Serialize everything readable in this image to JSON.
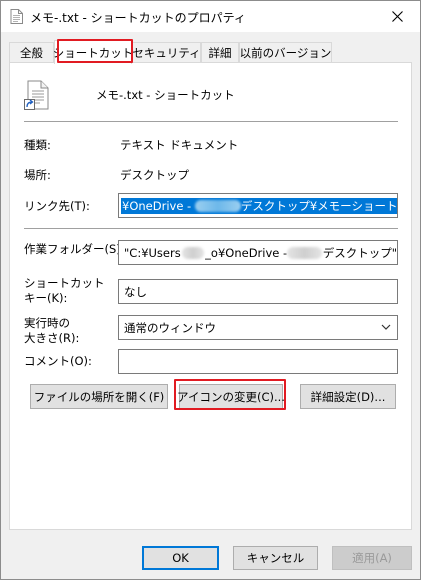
{
  "window": {
    "title": "メモ-.txt - ショートカットのプロパティ"
  },
  "tabs": [
    {
      "label": "全般"
    },
    {
      "label": "ショートカット"
    },
    {
      "label": "セキュリティ"
    },
    {
      "label": "詳細"
    },
    {
      "label": "以前のバージョン"
    }
  ],
  "shortcut": {
    "name": "メモ-.txt - ショートカット",
    "type_label": "種類:",
    "type_value": "テキスト ドキュメント",
    "location_label": "場所:",
    "location_value": "デスクトップ",
    "target_label": "リンク先(T):",
    "target_value_start": "¥OneDrive - ",
    "target_value_end": "デスクトップ¥メモーショートカット.txt\"",
    "startin_label": "作業フォルダー(S):",
    "startin_value_start": "\"C:¥Users",
    "startin_value_mid": "_o¥OneDrive - ",
    "startin_value_end": "デスクトップ\"",
    "hotkey_label_1": "ショートカット",
    "hotkey_label_2": "キー(K):",
    "hotkey_value": "なし",
    "run_label_1": "実行時の",
    "run_label_2": "大きさ(R):",
    "run_value": "通常のウィンドウ",
    "comment_label": "コメント(O):",
    "comment_value": ""
  },
  "buttons": {
    "open_location": "ファイルの場所を開く(F)",
    "change_icon": "アイコンの変更(C)...",
    "advanced": "詳細設定(D)...",
    "ok": "OK",
    "cancel": "キャンセル",
    "apply": "適用(A)"
  },
  "colors": {
    "highlight": "#e11b22",
    "selection": "#0078d7"
  }
}
